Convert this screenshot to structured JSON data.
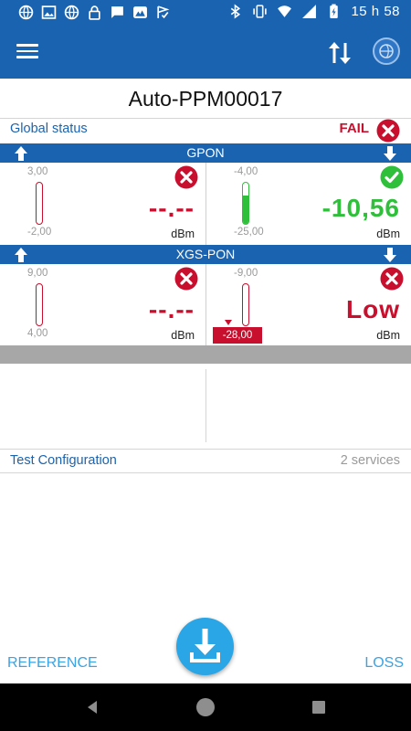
{
  "status_bar": {
    "time": "15 h 58",
    "icons_left": [
      "globe-icon",
      "image-icon",
      "globe-icon",
      "lock-icon",
      "message-icon",
      "mountain-icon",
      "check-flag-icon"
    ],
    "icons_right": [
      "bluetooth-icon",
      "vibrate-icon",
      "wifi-icon",
      "signal-icon",
      "battery-charging-icon"
    ]
  },
  "app_bar": {
    "menu_icon": "hamburger-icon",
    "transfer_icon": "up-down-arrows-icon",
    "network_icon": "globe-network-icon"
  },
  "title": "Auto-PPM00017",
  "global_status": {
    "label": "Global status",
    "result": "FAIL",
    "result_color": "#c8102e"
  },
  "bands": [
    {
      "name": "GPON",
      "upstream": {
        "scale_top": "3,00",
        "scale_bottom": "-2,00",
        "value": "--.--",
        "unit": "dBm",
        "status": "fail",
        "fill_fraction": 0
      },
      "downstream": {
        "scale_top": "-4,00",
        "scale_bottom": "-25,00",
        "value": "-10,56",
        "unit": "dBm",
        "status": "pass",
        "fill_fraction": 0.7
      }
    },
    {
      "name": "XGS-PON",
      "upstream": {
        "scale_top": "9,00",
        "scale_bottom": "4,00",
        "value": "--.--",
        "unit": "dBm",
        "status": "fail",
        "fill_fraction": 0
      },
      "downstream": {
        "scale_top": "-9,00",
        "scale_bottom": "-28,00",
        "value": "Low",
        "unit": "dBm",
        "status": "fail",
        "fill_fraction": 0
      }
    }
  ],
  "test_configuration": {
    "label": "Test Configuration",
    "count": "2 services"
  },
  "bottom": {
    "reference_label": "REFERENCE",
    "loss_label": "LOSS",
    "fab_icon": "download-icon"
  },
  "colors": {
    "primary": "#1a63b1",
    "fail": "#c8102e",
    "pass": "#2fbf3a",
    "accent": "#3aa3e3"
  }
}
